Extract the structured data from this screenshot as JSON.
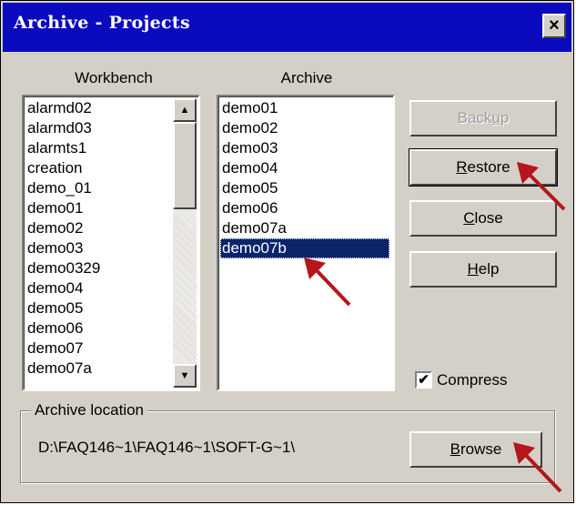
{
  "window": {
    "title": "Archive - Projects",
    "close_glyph": "×"
  },
  "workbench": {
    "label": "Workbench",
    "items": [
      "alarmd02",
      "alarmd03",
      "alarmts1",
      "creation",
      "demo_01",
      "demo01",
      "demo02",
      "demo03",
      "demo0329",
      "demo04",
      "demo05",
      "demo06",
      "demo07",
      "demo07a"
    ],
    "scroll_up_icon": "▲",
    "scroll_down_icon": "▼"
  },
  "archive": {
    "label": "Archive",
    "items": [
      "demo01",
      "demo02",
      "demo03",
      "demo04",
      "demo05",
      "demo06",
      "demo07a",
      "demo07b"
    ],
    "selected": "demo07b"
  },
  "buttons": {
    "backup": {
      "label": "Backup",
      "mnemonic": "u",
      "enabled": false
    },
    "restore": {
      "label": "Restore",
      "mnemonic": "R",
      "enabled": true
    },
    "close": {
      "label": "Close",
      "mnemonic": "C",
      "enabled": true
    },
    "help": {
      "label": "Help",
      "mnemonic": "H",
      "enabled": true
    },
    "browse": {
      "label": "Browse",
      "mnemonic": "B",
      "enabled": true
    }
  },
  "compress": {
    "label": "Compress",
    "checked": true,
    "check_glyph": "✔"
  },
  "location": {
    "group_label": "Archive location",
    "path": "D:\\FAQ146~1\\FAQ146~1\\SOFT-G~1\\"
  },
  "colors": {
    "title_bar": "#0a0bbf",
    "selection": "#0a246a",
    "annotation_arrow": "#b4161b"
  }
}
